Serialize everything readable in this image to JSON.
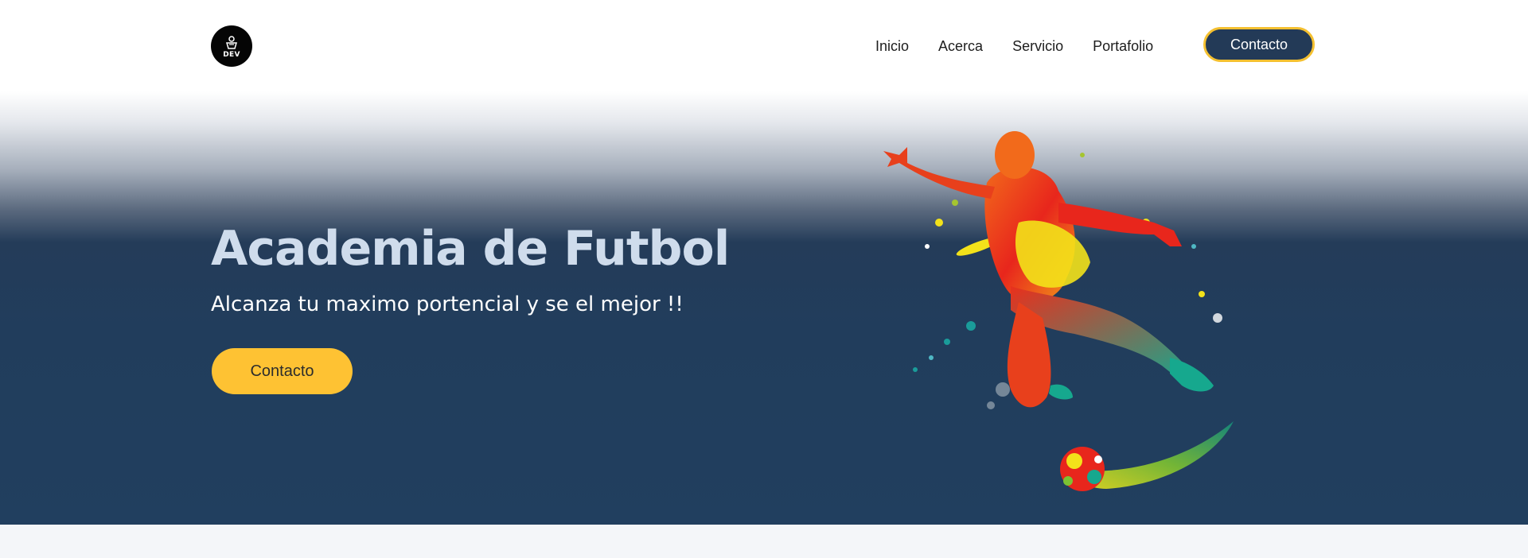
{
  "header": {
    "logo_text": "DEV",
    "nav": [
      {
        "label": "Inicio"
      },
      {
        "label": "Acerca"
      },
      {
        "label": "Servicio"
      },
      {
        "label": "Portafolio"
      }
    ],
    "contact_button": "Contacto"
  },
  "hero": {
    "title": "Academia de Futbol",
    "subtitle": "Alcanza tu maximo portencial y se el mejor !!",
    "cta_button": "Contacto",
    "illustration_icon": "soccer-player-paint-splash",
    "colors": {
      "background": "#213f5f",
      "title": "#cfdcec",
      "cta": "#fec233"
    }
  }
}
